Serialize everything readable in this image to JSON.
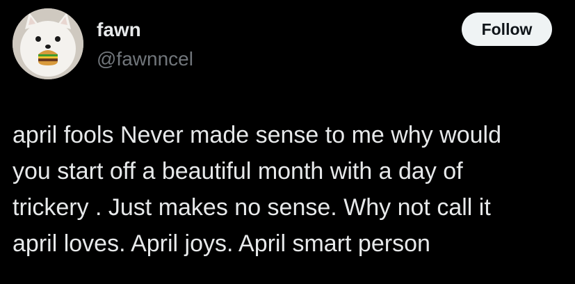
{
  "author": {
    "display_name": "fawn",
    "handle": "@fawnncel",
    "avatar_icon": "samoyed-with-burger-avatar"
  },
  "follow_button": {
    "label": "Follow"
  },
  "tweet": {
    "lines": [
      "april fools Never made sense to me why would",
      "you start off a beautiful month with a day of",
      "trickery . Just makes no sense. Why not call it",
      "april loves. April joys. April smart person"
    ]
  },
  "colors": {
    "background": "#000000",
    "primary_text": "#e7e9ea",
    "secondary_text": "#71767b",
    "button_bg": "#eff3f4",
    "button_text": "#0f1419"
  }
}
